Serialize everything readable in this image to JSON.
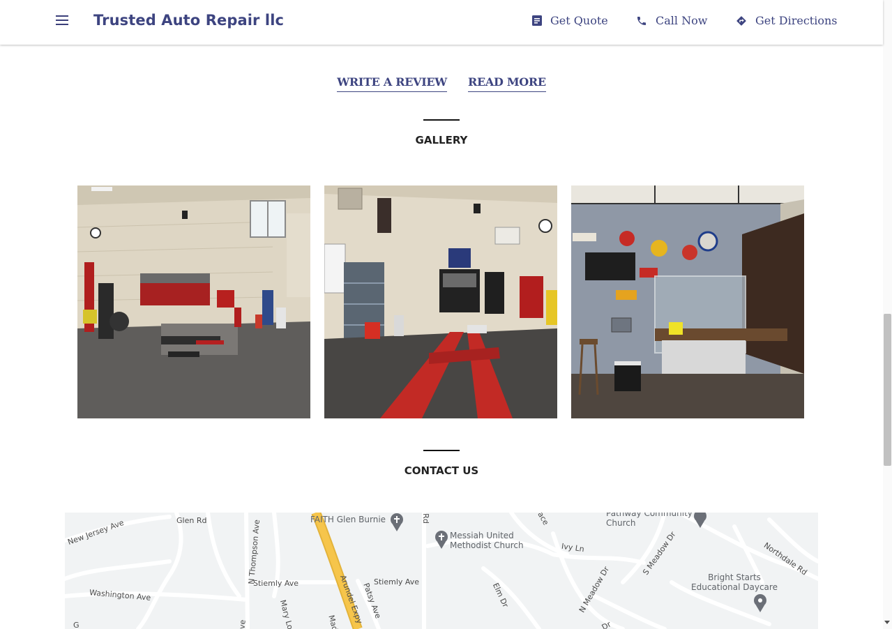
{
  "header": {
    "brand": "Trusted Auto Repair llc",
    "links": [
      {
        "label": "Get Quote",
        "icon": "document-icon"
      },
      {
        "label": "Call Now",
        "icon": "phone-icon"
      },
      {
        "label": "Get Directions",
        "icon": "directions-icon"
      }
    ]
  },
  "reviews": {
    "write_label": "WRITE A REVIEW",
    "read_label": "READ MORE"
  },
  "gallery": {
    "title": "GALLERY",
    "photos": [
      "Garage bay with lift",
      "Garage bay with red lift",
      "Waiting room with signs"
    ]
  },
  "contact": {
    "title": "CONTACT US"
  },
  "map": {
    "roads": [
      "New Jersey Ave",
      "Glen Rd",
      "N Thompson Ave",
      "Stiemly Ave",
      "Stiemly Ave",
      "Washington Ave",
      "Arundel Expy",
      "Patsy Ave",
      "Mary Lo",
      "Mad",
      "Ivy Ln",
      "Elm Dr",
      "N Meadow Dr",
      "S Meadow Dr",
      "Northdale Rd",
      "Rd",
      "ace",
      "Dr",
      "ve",
      "G"
    ],
    "pois": [
      {
        "name": "FAITH Glen Burnie"
      },
      {
        "name": "Messiah United Methodist Church"
      },
      {
        "name": "Pathway Community Church"
      },
      {
        "name": "Bright Starts Educational Daycare"
      }
    ]
  },
  "colors": {
    "brand": "#3d4480",
    "highway": "#f6c54b",
    "map_bg": "#f1f3f4"
  }
}
